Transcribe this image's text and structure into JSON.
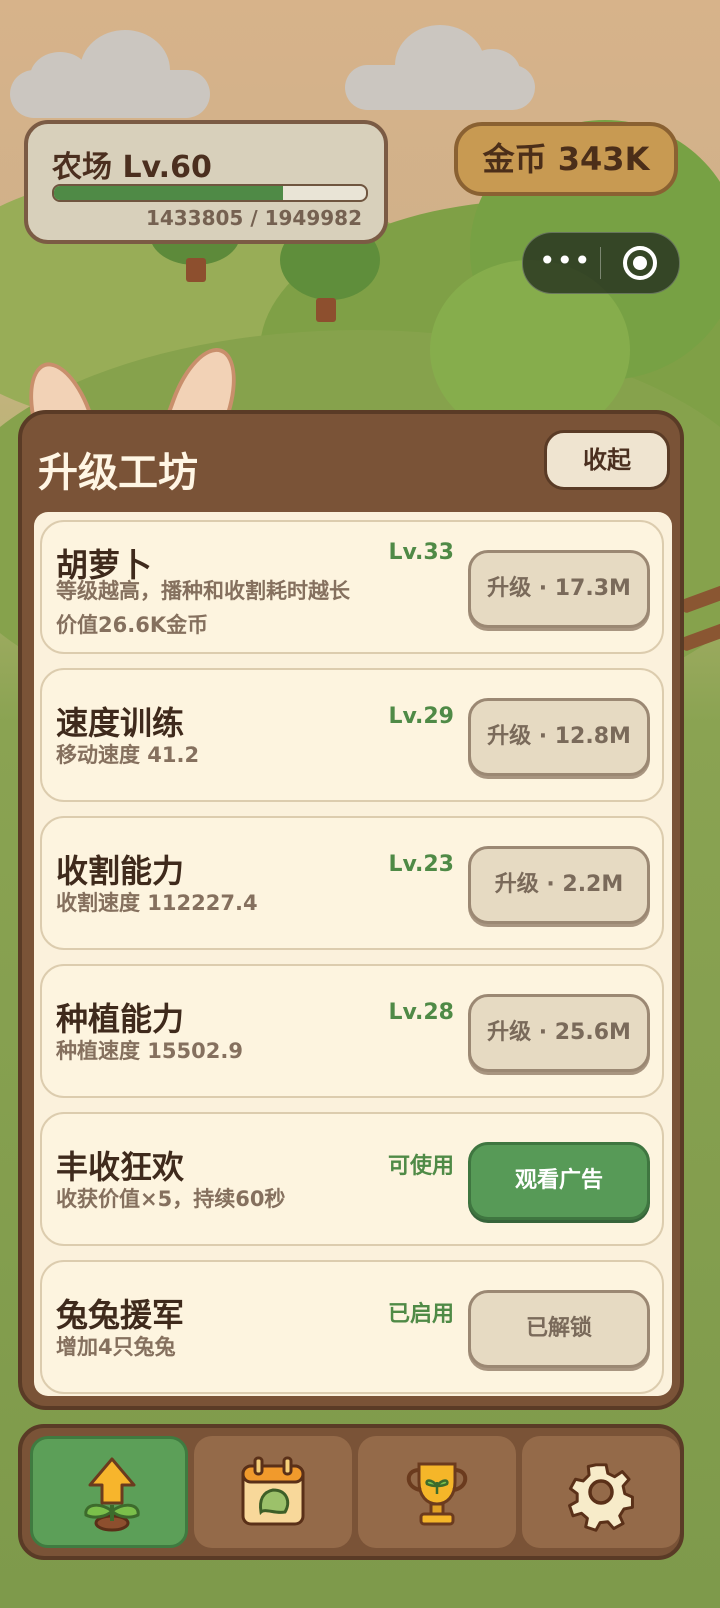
{
  "hud": {
    "farm_level": "农场 Lv.60",
    "xp_text": "1433805 / 1949982",
    "xp_progress": 0.7353,
    "coins": "金币 343K",
    "capsule_more": "•••",
    "capsule_more_icon": "more-dots-icon",
    "capsule_close_icon": "close-target-icon"
  },
  "workshop": {
    "title": "升级工坊",
    "collapse_label": "收起",
    "items": [
      {
        "name": "胡萝卜",
        "level": "Lv.33",
        "desc1": "等级越高，播种和收割耗时越长",
        "desc2": "价值26.6K金币",
        "button": "升级 · 17.3M"
      },
      {
        "name": "速度训练",
        "level": "Lv.29",
        "desc1": "移动速度 41.2",
        "button": "升级 · 12.8M"
      },
      {
        "name": "收割能力",
        "level": "Lv.23",
        "desc1": "收割速度 112227.4",
        "button": "升级 · 2.2M"
      },
      {
        "name": "种植能力",
        "level": "Lv.28",
        "desc1": "种植速度 15502.9",
        "button": "升级 · 25.6M"
      },
      {
        "name": "丰收狂欢",
        "level": "可使用",
        "desc1": "收获价值×5，持续60秒",
        "button": "观看广告"
      },
      {
        "name": "兔兔援军",
        "level": "已启用",
        "desc1": "增加4只兔兔",
        "button": "已解锁"
      }
    ]
  },
  "nav": {
    "tabs": [
      {
        "icon": "upgrade-sprout-icon",
        "active": true
      },
      {
        "icon": "calendar-leaf-icon",
        "active": false
      },
      {
        "icon": "trophy-icon",
        "active": false
      },
      {
        "icon": "gear-icon",
        "active": false
      }
    ]
  },
  "colors": {
    "panel_brown": "#7a5337",
    "accent_green": "#579a57",
    "coin_gold": "#c89a52",
    "card_cream": "#fdf4df"
  }
}
